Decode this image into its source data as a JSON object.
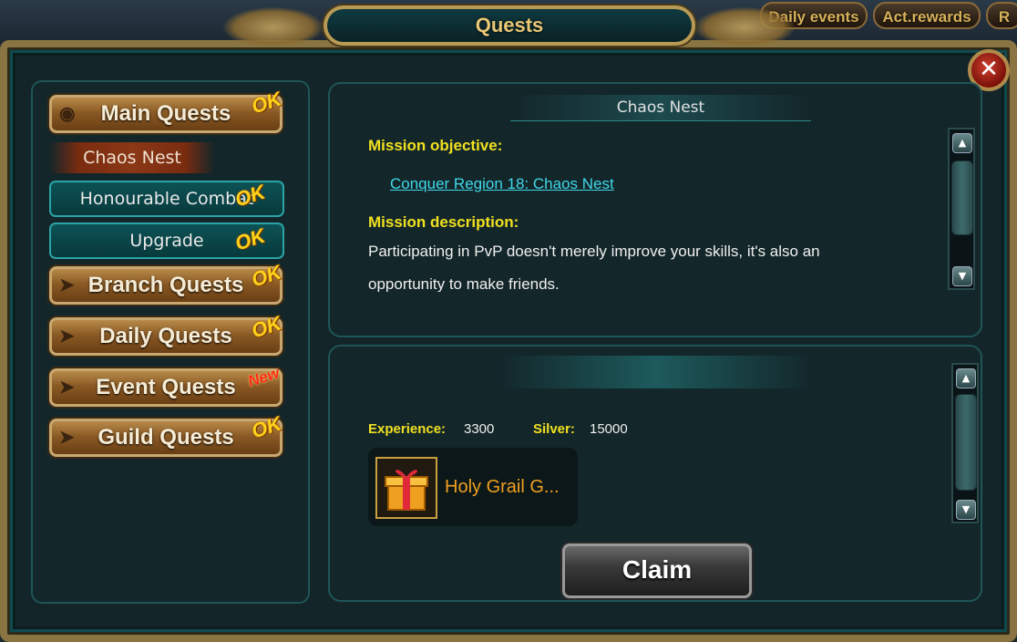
{
  "top_tabs": {
    "daily_events": "Daily events",
    "act_rewards": "Act.rewards",
    "partial": "R"
  },
  "window": {
    "title": "Quests",
    "close": "✕"
  },
  "left": {
    "main_quests": "Main Quests",
    "selected_sub": "Chaos Nest",
    "sub_items": [
      "Honourable Combat",
      "Upgrade"
    ],
    "categories": [
      "Branch Quests",
      "Daily Quests",
      "Event Quests",
      "Guild Quests"
    ],
    "badge_ok": "OK",
    "badge_new": "New"
  },
  "mission": {
    "title": "Chaos Nest",
    "objective_label": "Mission objective:",
    "objective_link": "Conquer Region 18: Chaos Nest",
    "description_label": "Mission description:",
    "description_line1": "Participating in PvP doesn't merely improve your skills, it's also an",
    "description_line2": "opportunity to make friends."
  },
  "reward": {
    "experience_label": "Experience:",
    "experience_value": "3300",
    "silver_label": "Silver:",
    "silver_value": "15000",
    "item_name": "Holy Grail G..."
  },
  "claim_label": "Claim",
  "colors": {
    "gold_text": "#e8c875",
    "label_yellow": "#f0e020",
    "link_cyan": "#40d8e8",
    "item_orange": "#f0a020"
  }
}
